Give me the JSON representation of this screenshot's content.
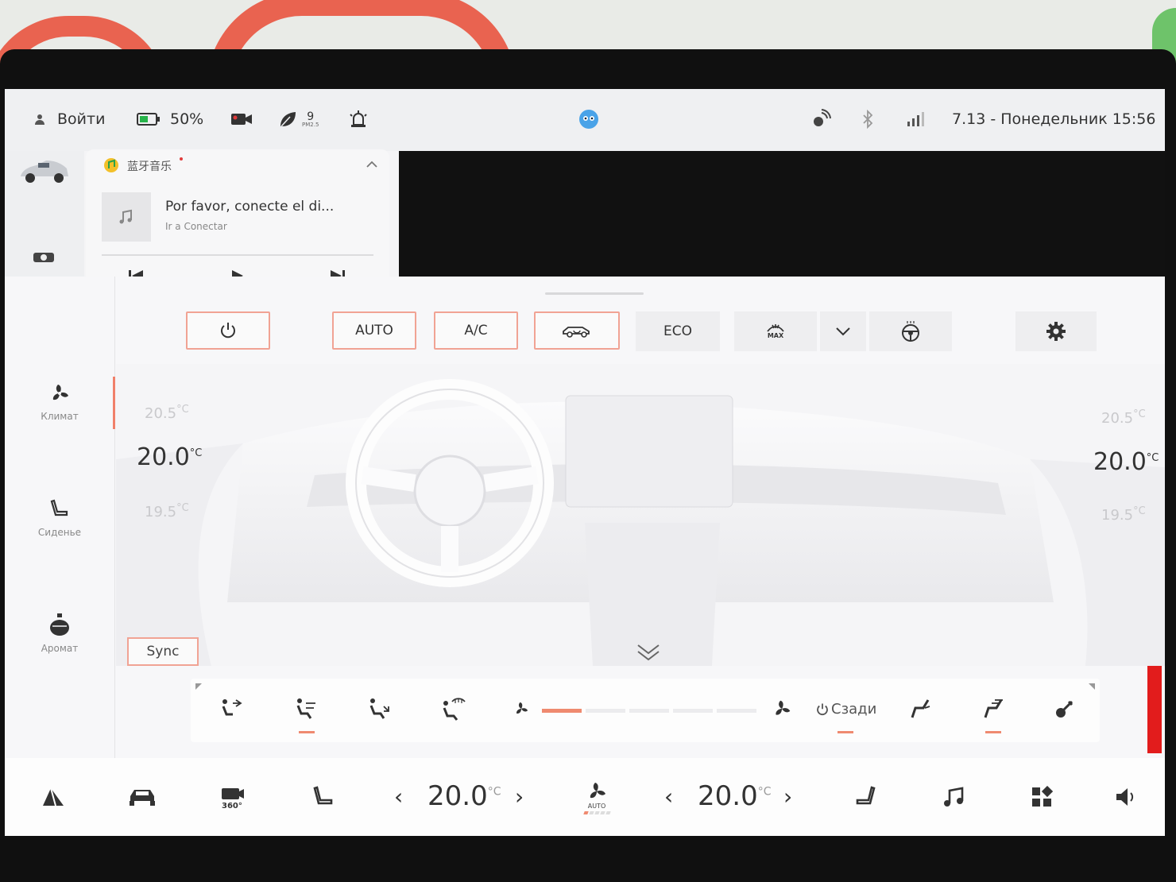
{
  "statusbar": {
    "login_label": "Войти",
    "battery_percent": "50%",
    "pm_value": "9",
    "pm_unit": "PM2.5",
    "datetime": "7.13 - Понедельник 15:56"
  },
  "music": {
    "app_name": "蓝牙音乐",
    "title": "Por favor, conecte el di...",
    "subtitle": "Ir a Conectar"
  },
  "sidenav": {
    "items": [
      {
        "label": "Климат",
        "icon": "fan-icon"
      },
      {
        "label": "Сиденье",
        "icon": "seat-icon"
      },
      {
        "label": "Аромат",
        "icon": "perfume-icon"
      }
    ]
  },
  "controls": {
    "auto_label": "AUTO",
    "ac_label": "A/C",
    "eco_label": "ECO",
    "max_label": "MAX",
    "sync_label": "Sync"
  },
  "temps": {
    "left": {
      "upper": "20.5",
      "current": "20.0",
      "lower": "19.5"
    },
    "right": {
      "upper": "20.5",
      "current": "20.0",
      "lower": "19.5"
    },
    "unit": "°C"
  },
  "airflow": {
    "rear_label": "Сзади",
    "fan_level": 1,
    "fan_segments": 5
  },
  "dock": {
    "left_temp": "20.0",
    "right_temp": "20.0",
    "unit": "°C",
    "fan_mode_label": "AUTO"
  },
  "colors": {
    "accent": "#f1a394",
    "accent_strong": "#ef8a70",
    "alert_red": "#e21c1c",
    "battery_green": "#27b34a"
  }
}
